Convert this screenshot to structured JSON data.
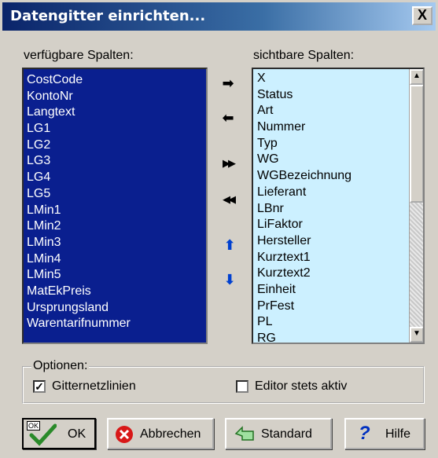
{
  "window": {
    "title": "Datengitter einrichten...",
    "close_glyph": "X"
  },
  "available": {
    "label": "verfügbare Spalten:",
    "items": [
      "CostCode",
      "KontoNr",
      "Langtext",
      "LG1",
      "LG2",
      "LG3",
      "LG4",
      "LG5",
      "LMin1",
      "LMin2",
      "LMin3",
      "LMin4",
      "LMin5",
      "MatEkPreis",
      "Ursprungsland",
      "Warentarifnummer"
    ]
  },
  "visible": {
    "label": "sichtbare Spalten:",
    "items": [
      "X",
      "Status",
      "Art",
      "Nummer",
      "Typ",
      "WG",
      "WGBezeichnung",
      "Lieferant",
      "LBnr",
      "LiFaktor",
      "Hersteller",
      "Kurztext1",
      "Kurztext2",
      "Einheit",
      "PrFest",
      "PL",
      "RG"
    ]
  },
  "move_buttons": {
    "add": "➡",
    "remove": "⬅",
    "add_all": "▶▶",
    "remove_all": "◀◀",
    "up": "⬆",
    "down": "⬇"
  },
  "options": {
    "legend": "Optionen:",
    "gridlines_label": "Gitternetzlinien",
    "gridlines_checked": "✓",
    "editor_label": "Editor stets aktiv",
    "editor_checked": ""
  },
  "buttons": {
    "ok": "OK",
    "ok_badge": "OK",
    "cancel": "Abbrechen",
    "default": "Standard",
    "help": "Hilfe"
  },
  "colors": {
    "title_start": "#0a246a",
    "left_list_bg": "#0a1f8f",
    "right_list_bg": "#ccf0ff"
  }
}
